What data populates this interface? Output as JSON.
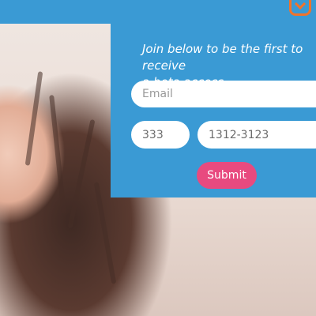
{
  "brand": {
    "logo_icon": "orange-bracket-logo",
    "accent": "#f0732b"
  },
  "signup": {
    "tagline": "Join below to be the first to receive\na beta access",
    "email_placeholder": "Email",
    "area_code_value": "333",
    "phone_value": "1312-3123",
    "submit_label": "Submit"
  },
  "colors": {
    "panel": "#3a9ad4",
    "button": "#e84a7f",
    "field": "#ffffff"
  }
}
